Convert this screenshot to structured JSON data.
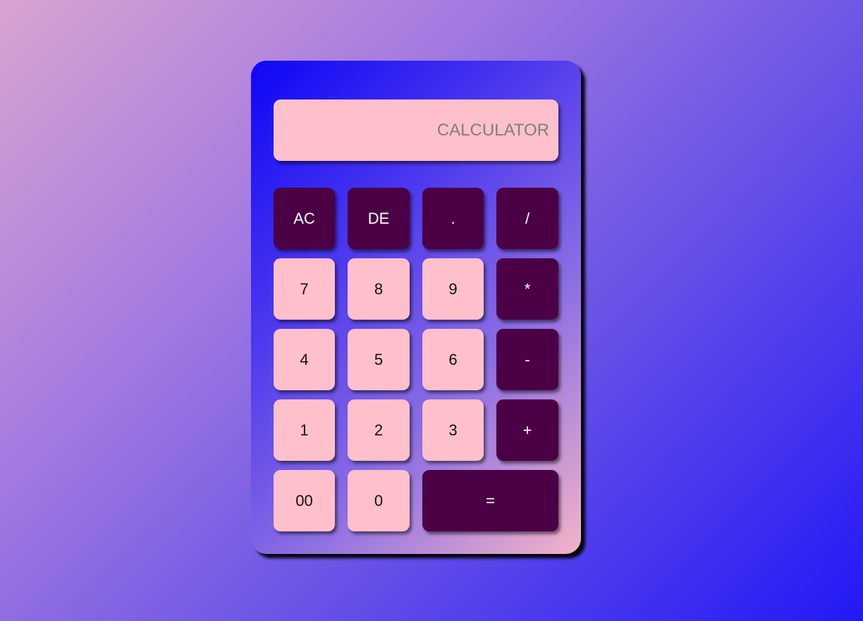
{
  "display": {
    "placeholder": "CALCULATOR",
    "value": ""
  },
  "keys": [
    {
      "label": "AC",
      "kind": "op"
    },
    {
      "label": "DE",
      "kind": "op"
    },
    {
      "label": ".",
      "kind": "op"
    },
    {
      "label": "/",
      "kind": "op"
    },
    {
      "label": "7",
      "kind": "num"
    },
    {
      "label": "8",
      "kind": "num"
    },
    {
      "label": "9",
      "kind": "num"
    },
    {
      "label": "*",
      "kind": "op"
    },
    {
      "label": "4",
      "kind": "num"
    },
    {
      "label": "5",
      "kind": "num"
    },
    {
      "label": "6",
      "kind": "num"
    },
    {
      "label": "-",
      "kind": "op"
    },
    {
      "label": "1",
      "kind": "num"
    },
    {
      "label": "2",
      "kind": "num"
    },
    {
      "label": "3",
      "kind": "num"
    },
    {
      "label": "+",
      "kind": "op"
    },
    {
      "label": "00",
      "kind": "num"
    },
    {
      "label": "0",
      "kind": "num"
    },
    {
      "label": "=",
      "kind": "op"
    }
  ],
  "colors": {
    "operator_key": "#4b0046",
    "number_key": "#ffc0cb",
    "display_bg": "#ffc0cb"
  }
}
